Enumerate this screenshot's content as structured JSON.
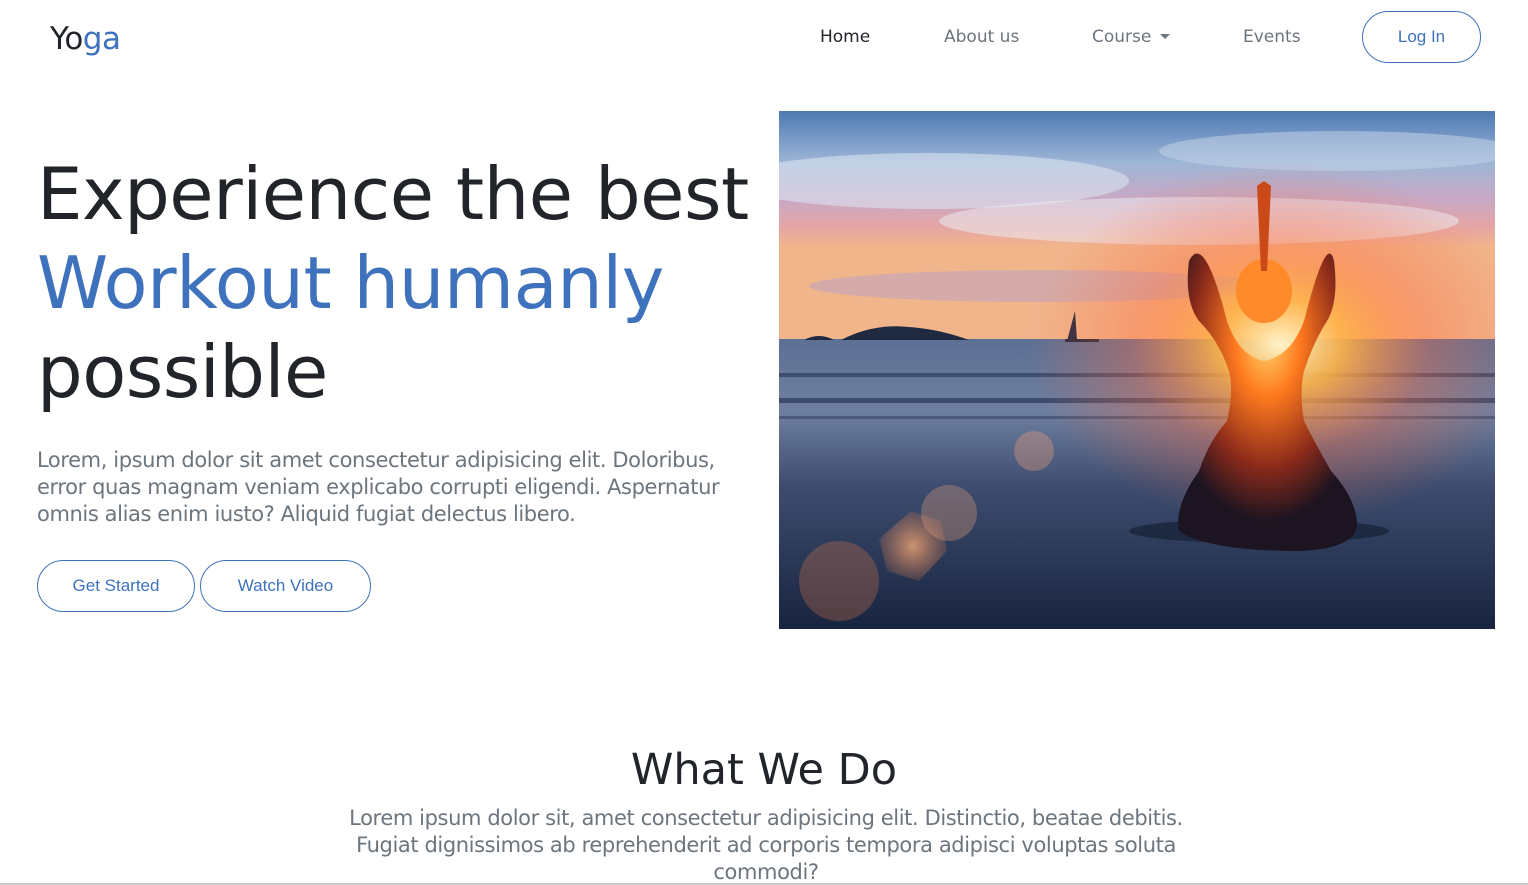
{
  "nav": {
    "brand_part1": "Yo",
    "brand_part2": "ga",
    "items": [
      {
        "label": "Home"
      },
      {
        "label": "About us"
      },
      {
        "label": "Course"
      },
      {
        "label": "Events"
      }
    ],
    "login_label": "Log In"
  },
  "hero": {
    "title_line1": "Experience the best",
    "title_line2": "Workout humanly",
    "title_line3": "possible",
    "description": "Lorem, ipsum dolor sit amet consectetur adipisicing elit. Doloribus, error quas magnam veniam explicabo corrupti eligendi. Aspernatur omnis alias enim iusto? Aliquid fugiat delectus libero.",
    "get_started_label": "Get Started",
    "watch_video_label": "Watch Video"
  },
  "what_we_do": {
    "title": "What We Do",
    "description": "Lorem ipsum dolor sit, amet consectetur adipisicing elit. Distinctio, beatae debitis. Fugiat dignissimos ab reprehenderit ad corporis tempora adipisci voluptas soluta commodi?"
  },
  "colors": {
    "accent": "#3f72bd",
    "text_dark": "#212529",
    "text_muted": "#6c757d"
  },
  "icons": {
    "course_dropdown": "caret-down-icon"
  }
}
